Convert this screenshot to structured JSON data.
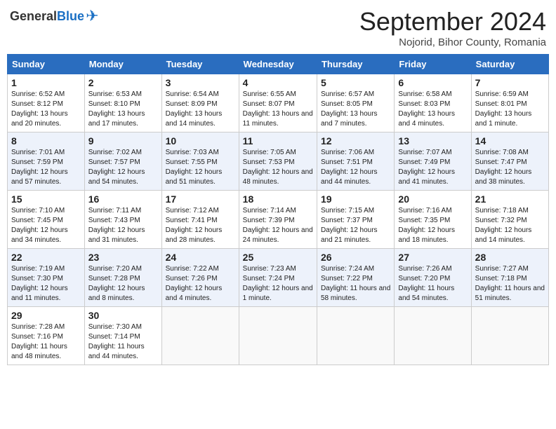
{
  "header": {
    "logo_general": "General",
    "logo_blue": "Blue",
    "month_title": "September 2024",
    "location": "Nojorid, Bihor County, Romania"
  },
  "weekdays": [
    "Sunday",
    "Monday",
    "Tuesday",
    "Wednesday",
    "Thursday",
    "Friday",
    "Saturday"
  ],
  "weeks": [
    [
      {
        "day": "1",
        "info": "Sunrise: 6:52 AM\nSunset: 8:12 PM\nDaylight: 13 hours and 20 minutes."
      },
      {
        "day": "2",
        "info": "Sunrise: 6:53 AM\nSunset: 8:10 PM\nDaylight: 13 hours and 17 minutes."
      },
      {
        "day": "3",
        "info": "Sunrise: 6:54 AM\nSunset: 8:09 PM\nDaylight: 13 hours and 14 minutes."
      },
      {
        "day": "4",
        "info": "Sunrise: 6:55 AM\nSunset: 8:07 PM\nDaylight: 13 hours and 11 minutes."
      },
      {
        "day": "5",
        "info": "Sunrise: 6:57 AM\nSunset: 8:05 PM\nDaylight: 13 hours and 7 minutes."
      },
      {
        "day": "6",
        "info": "Sunrise: 6:58 AM\nSunset: 8:03 PM\nDaylight: 13 hours and 4 minutes."
      },
      {
        "day": "7",
        "info": "Sunrise: 6:59 AM\nSunset: 8:01 PM\nDaylight: 13 hours and 1 minute."
      }
    ],
    [
      {
        "day": "8",
        "info": "Sunrise: 7:01 AM\nSunset: 7:59 PM\nDaylight: 12 hours and 57 minutes."
      },
      {
        "day": "9",
        "info": "Sunrise: 7:02 AM\nSunset: 7:57 PM\nDaylight: 12 hours and 54 minutes."
      },
      {
        "day": "10",
        "info": "Sunrise: 7:03 AM\nSunset: 7:55 PM\nDaylight: 12 hours and 51 minutes."
      },
      {
        "day": "11",
        "info": "Sunrise: 7:05 AM\nSunset: 7:53 PM\nDaylight: 12 hours and 48 minutes."
      },
      {
        "day": "12",
        "info": "Sunrise: 7:06 AM\nSunset: 7:51 PM\nDaylight: 12 hours and 44 minutes."
      },
      {
        "day": "13",
        "info": "Sunrise: 7:07 AM\nSunset: 7:49 PM\nDaylight: 12 hours and 41 minutes."
      },
      {
        "day": "14",
        "info": "Sunrise: 7:08 AM\nSunset: 7:47 PM\nDaylight: 12 hours and 38 minutes."
      }
    ],
    [
      {
        "day": "15",
        "info": "Sunrise: 7:10 AM\nSunset: 7:45 PM\nDaylight: 12 hours and 34 minutes."
      },
      {
        "day": "16",
        "info": "Sunrise: 7:11 AM\nSunset: 7:43 PM\nDaylight: 12 hours and 31 minutes."
      },
      {
        "day": "17",
        "info": "Sunrise: 7:12 AM\nSunset: 7:41 PM\nDaylight: 12 hours and 28 minutes."
      },
      {
        "day": "18",
        "info": "Sunrise: 7:14 AM\nSunset: 7:39 PM\nDaylight: 12 hours and 24 minutes."
      },
      {
        "day": "19",
        "info": "Sunrise: 7:15 AM\nSunset: 7:37 PM\nDaylight: 12 hours and 21 minutes."
      },
      {
        "day": "20",
        "info": "Sunrise: 7:16 AM\nSunset: 7:35 PM\nDaylight: 12 hours and 18 minutes."
      },
      {
        "day": "21",
        "info": "Sunrise: 7:18 AM\nSunset: 7:32 PM\nDaylight: 12 hours and 14 minutes."
      }
    ],
    [
      {
        "day": "22",
        "info": "Sunrise: 7:19 AM\nSunset: 7:30 PM\nDaylight: 12 hours and 11 minutes."
      },
      {
        "day": "23",
        "info": "Sunrise: 7:20 AM\nSunset: 7:28 PM\nDaylight: 12 hours and 8 minutes."
      },
      {
        "day": "24",
        "info": "Sunrise: 7:22 AM\nSunset: 7:26 PM\nDaylight: 12 hours and 4 minutes."
      },
      {
        "day": "25",
        "info": "Sunrise: 7:23 AM\nSunset: 7:24 PM\nDaylight: 12 hours and 1 minute."
      },
      {
        "day": "26",
        "info": "Sunrise: 7:24 AM\nSunset: 7:22 PM\nDaylight: 11 hours and 58 minutes."
      },
      {
        "day": "27",
        "info": "Sunrise: 7:26 AM\nSunset: 7:20 PM\nDaylight: 11 hours and 54 minutes."
      },
      {
        "day": "28",
        "info": "Sunrise: 7:27 AM\nSunset: 7:18 PM\nDaylight: 11 hours and 51 minutes."
      }
    ],
    [
      {
        "day": "29",
        "info": "Sunrise: 7:28 AM\nSunset: 7:16 PM\nDaylight: 11 hours and 48 minutes."
      },
      {
        "day": "30",
        "info": "Sunrise: 7:30 AM\nSunset: 7:14 PM\nDaylight: 11 hours and 44 minutes."
      },
      null,
      null,
      null,
      null,
      null
    ]
  ]
}
